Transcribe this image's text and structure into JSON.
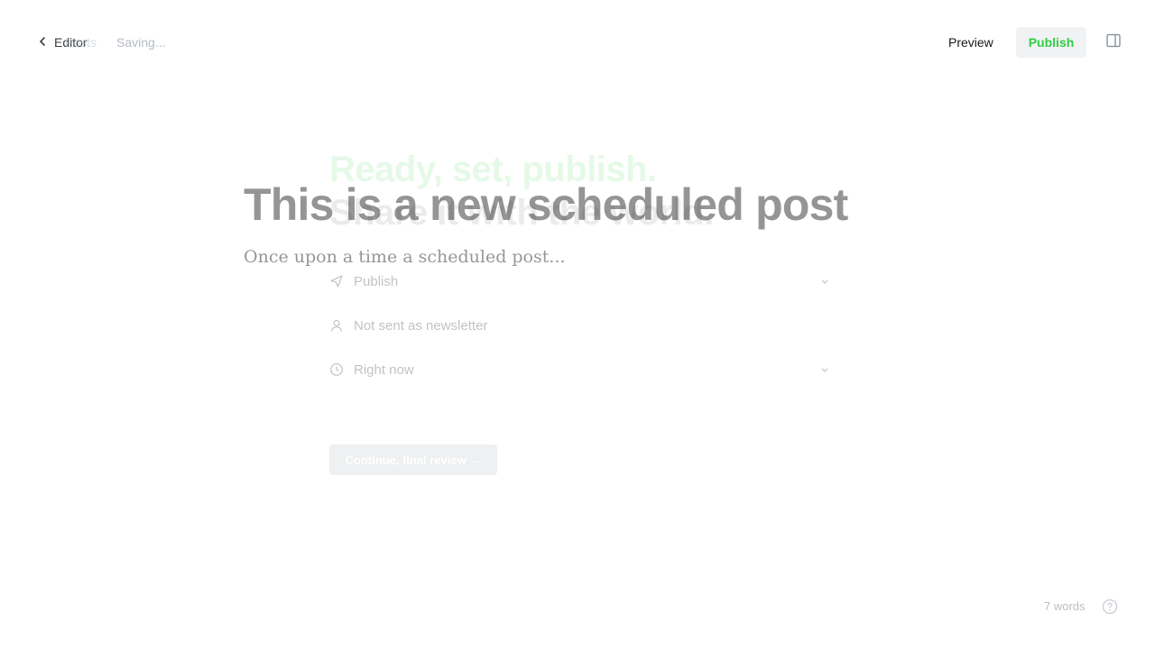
{
  "header": {
    "back_label": "Editor",
    "back_ghost_label": "Posts",
    "status": "Saving...",
    "preview_label": "Preview",
    "publish_label": "Publish"
  },
  "publish_flow": {
    "title_line1": "Ready, set, publish.",
    "title_line2": "Share it with the world.",
    "rows": [
      {
        "icon": "send-icon",
        "label": "Publish"
      },
      {
        "icon": "user-icon",
        "label": "Not sent as newsletter"
      },
      {
        "icon": "clock-icon",
        "label": "Right now"
      }
    ],
    "continue_label": "Continue, final review →"
  },
  "post": {
    "title": "This is a new scheduled post",
    "excerpt": "Once upon a time a scheduled post..."
  },
  "footer": {
    "word_count": "7 words"
  },
  "colors": {
    "accent_green": "#30cf43",
    "text_dark": "#15171a",
    "muted": "#b9bfc6"
  }
}
